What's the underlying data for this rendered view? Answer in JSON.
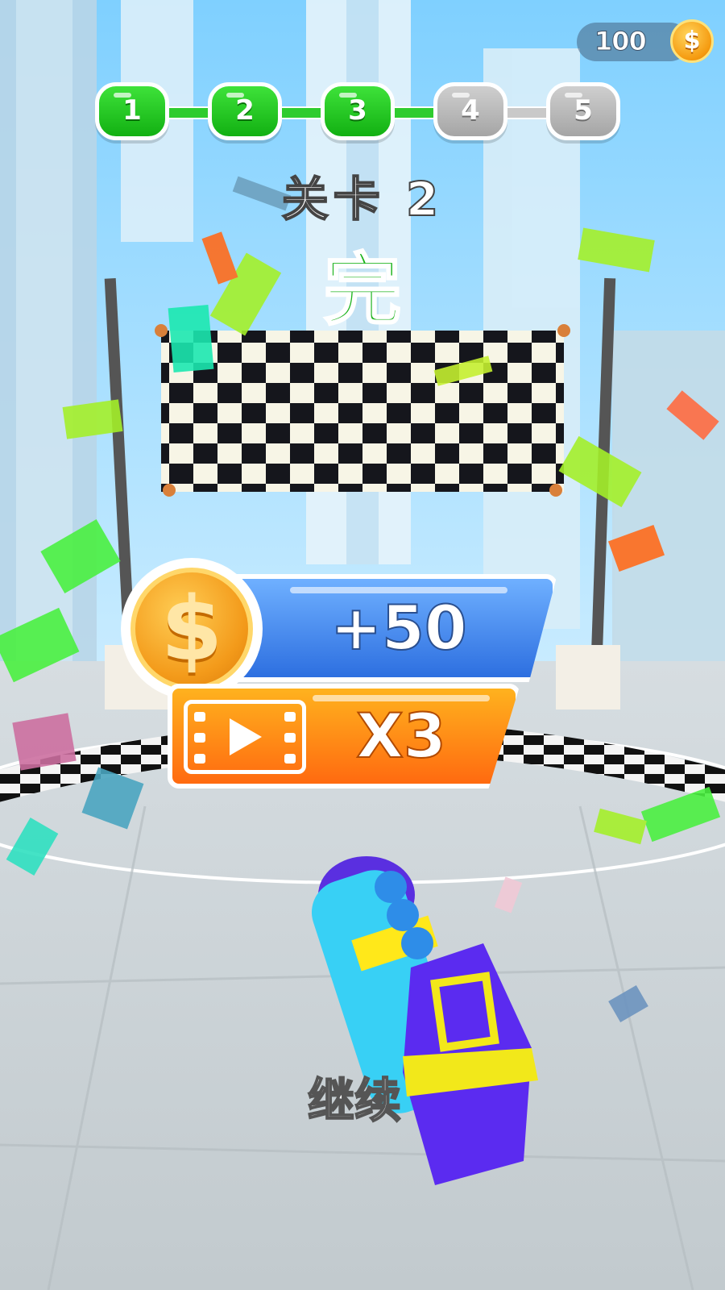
{
  "hud": {
    "coins": "100",
    "coin_symbol": "$"
  },
  "progress": {
    "stages": [
      {
        "label": "1",
        "state": "complete"
      },
      {
        "label": "2",
        "state": "complete"
      },
      {
        "label": "3",
        "state": "complete"
      },
      {
        "label": "4",
        "state": "locked"
      },
      {
        "label": "5",
        "state": "locked"
      }
    ]
  },
  "title": {
    "level": "关卡 2",
    "status": "完"
  },
  "reward": {
    "coin_symbol": "$",
    "amount": "+50",
    "multiplier_label": "X3"
  },
  "actions": {
    "continue_label": "继续"
  },
  "colors": {
    "complete_green": "#1bb31b",
    "reward_blue": "#2d6fe0",
    "video_orange": "#ff7a10",
    "coin_gold": "#f59a0f"
  }
}
